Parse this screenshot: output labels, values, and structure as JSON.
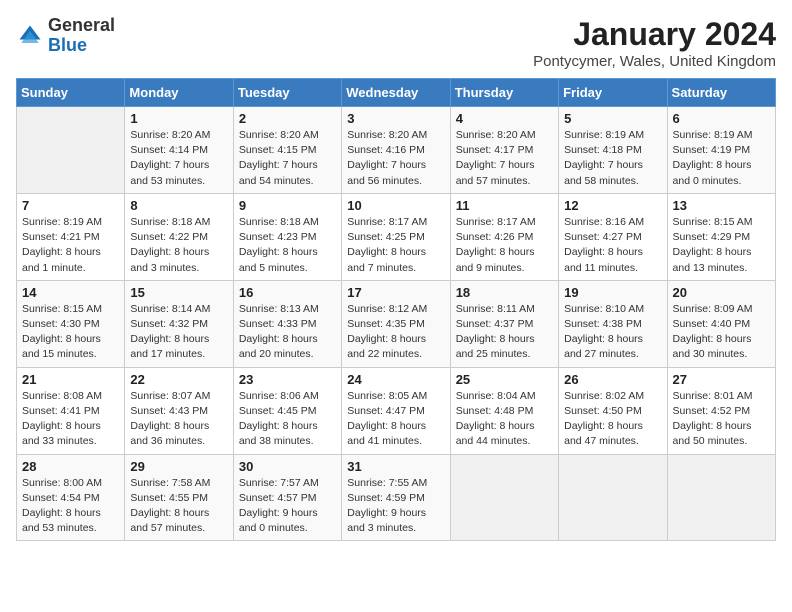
{
  "header": {
    "logo_general": "General",
    "logo_blue": "Blue",
    "month_title": "January 2024",
    "subtitle": "Pontycymer, Wales, United Kingdom"
  },
  "days_of_week": [
    "Sunday",
    "Monday",
    "Tuesday",
    "Wednesday",
    "Thursday",
    "Friday",
    "Saturday"
  ],
  "weeks": [
    [
      {
        "day": "",
        "info": ""
      },
      {
        "day": "1",
        "info": "Sunrise: 8:20 AM\nSunset: 4:14 PM\nDaylight: 7 hours\nand 53 minutes."
      },
      {
        "day": "2",
        "info": "Sunrise: 8:20 AM\nSunset: 4:15 PM\nDaylight: 7 hours\nand 54 minutes."
      },
      {
        "day": "3",
        "info": "Sunrise: 8:20 AM\nSunset: 4:16 PM\nDaylight: 7 hours\nand 56 minutes."
      },
      {
        "day": "4",
        "info": "Sunrise: 8:20 AM\nSunset: 4:17 PM\nDaylight: 7 hours\nand 57 minutes."
      },
      {
        "day": "5",
        "info": "Sunrise: 8:19 AM\nSunset: 4:18 PM\nDaylight: 7 hours\nand 58 minutes."
      },
      {
        "day": "6",
        "info": "Sunrise: 8:19 AM\nSunset: 4:19 PM\nDaylight: 8 hours\nand 0 minutes."
      }
    ],
    [
      {
        "day": "7",
        "info": "Sunrise: 8:19 AM\nSunset: 4:21 PM\nDaylight: 8 hours\nand 1 minute."
      },
      {
        "day": "8",
        "info": "Sunrise: 8:18 AM\nSunset: 4:22 PM\nDaylight: 8 hours\nand 3 minutes."
      },
      {
        "day": "9",
        "info": "Sunrise: 8:18 AM\nSunset: 4:23 PM\nDaylight: 8 hours\nand 5 minutes."
      },
      {
        "day": "10",
        "info": "Sunrise: 8:17 AM\nSunset: 4:25 PM\nDaylight: 8 hours\nand 7 minutes."
      },
      {
        "day": "11",
        "info": "Sunrise: 8:17 AM\nSunset: 4:26 PM\nDaylight: 8 hours\nand 9 minutes."
      },
      {
        "day": "12",
        "info": "Sunrise: 8:16 AM\nSunset: 4:27 PM\nDaylight: 8 hours\nand 11 minutes."
      },
      {
        "day": "13",
        "info": "Sunrise: 8:15 AM\nSunset: 4:29 PM\nDaylight: 8 hours\nand 13 minutes."
      }
    ],
    [
      {
        "day": "14",
        "info": "Sunrise: 8:15 AM\nSunset: 4:30 PM\nDaylight: 8 hours\nand 15 minutes."
      },
      {
        "day": "15",
        "info": "Sunrise: 8:14 AM\nSunset: 4:32 PM\nDaylight: 8 hours\nand 17 minutes."
      },
      {
        "day": "16",
        "info": "Sunrise: 8:13 AM\nSunset: 4:33 PM\nDaylight: 8 hours\nand 20 minutes."
      },
      {
        "day": "17",
        "info": "Sunrise: 8:12 AM\nSunset: 4:35 PM\nDaylight: 8 hours\nand 22 minutes."
      },
      {
        "day": "18",
        "info": "Sunrise: 8:11 AM\nSunset: 4:37 PM\nDaylight: 8 hours\nand 25 minutes."
      },
      {
        "day": "19",
        "info": "Sunrise: 8:10 AM\nSunset: 4:38 PM\nDaylight: 8 hours\nand 27 minutes."
      },
      {
        "day": "20",
        "info": "Sunrise: 8:09 AM\nSunset: 4:40 PM\nDaylight: 8 hours\nand 30 minutes."
      }
    ],
    [
      {
        "day": "21",
        "info": "Sunrise: 8:08 AM\nSunset: 4:41 PM\nDaylight: 8 hours\nand 33 minutes."
      },
      {
        "day": "22",
        "info": "Sunrise: 8:07 AM\nSunset: 4:43 PM\nDaylight: 8 hours\nand 36 minutes."
      },
      {
        "day": "23",
        "info": "Sunrise: 8:06 AM\nSunset: 4:45 PM\nDaylight: 8 hours\nand 38 minutes."
      },
      {
        "day": "24",
        "info": "Sunrise: 8:05 AM\nSunset: 4:47 PM\nDaylight: 8 hours\nand 41 minutes."
      },
      {
        "day": "25",
        "info": "Sunrise: 8:04 AM\nSunset: 4:48 PM\nDaylight: 8 hours\nand 44 minutes."
      },
      {
        "day": "26",
        "info": "Sunrise: 8:02 AM\nSunset: 4:50 PM\nDaylight: 8 hours\nand 47 minutes."
      },
      {
        "day": "27",
        "info": "Sunrise: 8:01 AM\nSunset: 4:52 PM\nDaylight: 8 hours\nand 50 minutes."
      }
    ],
    [
      {
        "day": "28",
        "info": "Sunrise: 8:00 AM\nSunset: 4:54 PM\nDaylight: 8 hours\nand 53 minutes."
      },
      {
        "day": "29",
        "info": "Sunrise: 7:58 AM\nSunset: 4:55 PM\nDaylight: 8 hours\nand 57 minutes."
      },
      {
        "day": "30",
        "info": "Sunrise: 7:57 AM\nSunset: 4:57 PM\nDaylight: 9 hours\nand 0 minutes."
      },
      {
        "day": "31",
        "info": "Sunrise: 7:55 AM\nSunset: 4:59 PM\nDaylight: 9 hours\nand 3 minutes."
      },
      {
        "day": "",
        "info": ""
      },
      {
        "day": "",
        "info": ""
      },
      {
        "day": "",
        "info": ""
      }
    ]
  ]
}
